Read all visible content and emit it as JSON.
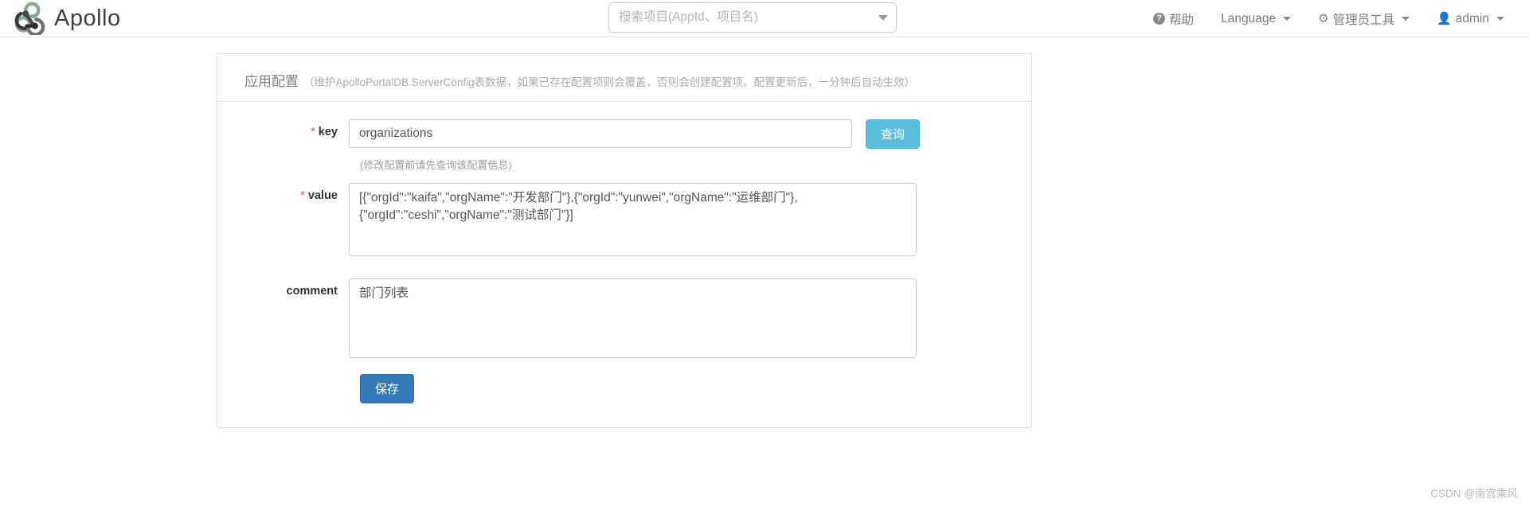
{
  "navbar": {
    "brand": "Apollo",
    "brand_logo_icon": "apollo-logo-icon",
    "search": {
      "placeholder": "搜索项目(AppId、项目名)",
      "value": "",
      "caret_icon": "chevron-down-icon"
    },
    "items": [
      {
        "label": "帮助",
        "icon": "question-circle-icon",
        "caret": false
      },
      {
        "label": "Language",
        "icon": "",
        "caret": true
      },
      {
        "label": "管理员工具",
        "icon": "gear-icon",
        "caret": true
      },
      {
        "label": "admin",
        "icon": "user-icon",
        "caret": true
      }
    ]
  },
  "panel": {
    "title": "应用配置",
    "description": "（维护ApolloPortalDB.ServerConfig表数据，如果已存在配置项则会覆盖，否则会创建配置项。配置更新后，一分钟后自动生效）"
  },
  "form": {
    "key": {
      "label": "key",
      "required_mark": "*",
      "value": "organizations",
      "placeholder": "",
      "hint": "(修改配置前请先查询该配置信息)"
    },
    "query_button": "查询",
    "value": {
      "label": "value",
      "required_mark": "*",
      "value": "[{\"orgId\":\"kaifa\",\"orgName\":\"开发部门\"},{\"orgId\":\"yunwei\",\"orgName\":\"运维部门\"},\n{\"orgId\":\"ceshi\",\"orgName\":\"测试部门\"}]",
      "placeholder": ""
    },
    "comment": {
      "label": "comment",
      "value": "部门列表",
      "placeholder": ""
    },
    "save_button": "保存"
  },
  "watermark": "CSDN @南宫乘风",
  "colors": {
    "query_button": "#5bc0de",
    "save_button": "#337ab7",
    "required_mark": "#d9534f",
    "logo_green": "#8aaa8f",
    "logo_dark": "#3f3f3f"
  }
}
